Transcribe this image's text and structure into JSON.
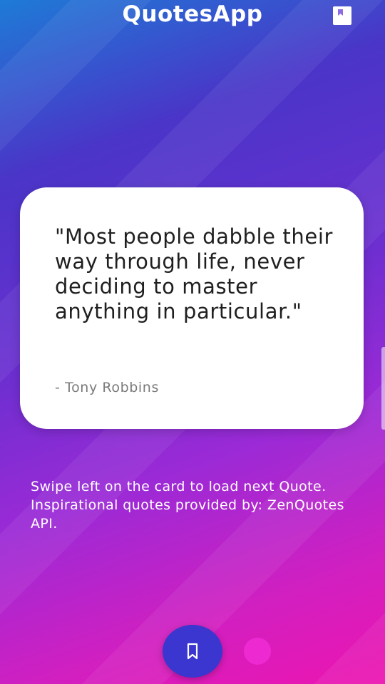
{
  "header": {
    "title": "QuotesApp",
    "saved_icon": "bookmark-icon"
  },
  "quote_card": {
    "text": "\"Most people dabble their way through life, never deciding to master anything in particular.\"",
    "author": "- Tony Robbins"
  },
  "hint": {
    "text": "Swipe left on the card to load next Quote. Inspirational quotes provided by: ZenQuotes API."
  },
  "fab": {
    "icon": "bookmark-outline-icon"
  },
  "colors": {
    "card_bg": "#ffffff",
    "fab_bg": "#3a36cf",
    "dot": "#f02dd6",
    "text_white": "#ffffff"
  }
}
